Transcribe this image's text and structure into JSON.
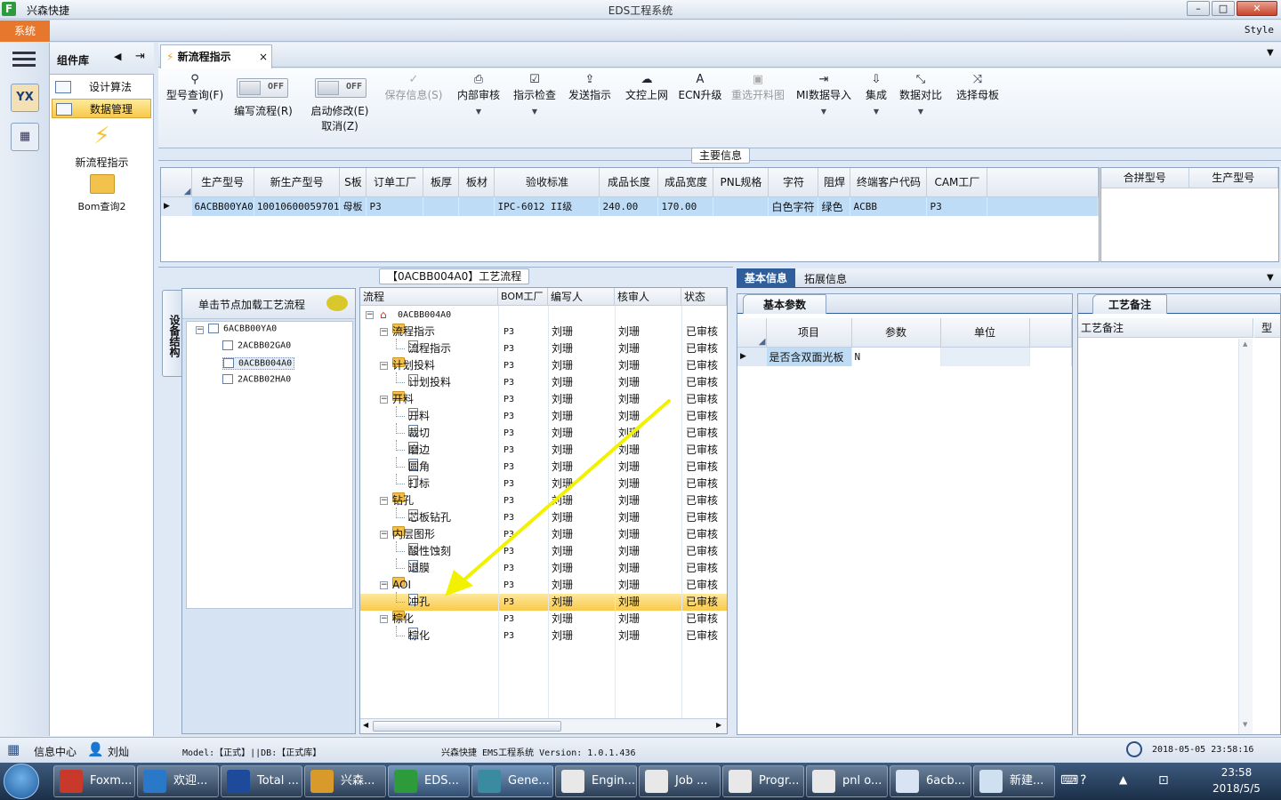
{
  "titlebar": {
    "app_name": "兴森快捷",
    "title": "EDS工程系统",
    "min": "–",
    "max": "□",
    "close": "✕"
  },
  "menubar": {
    "system_tab": "系统",
    "style_label": "Style"
  },
  "leftbar": {
    "icon1": "YX",
    "icon2": "▦"
  },
  "complib": {
    "title": "组件库",
    "items": [
      "设计算法",
      "数据管理"
    ],
    "big_items": [
      "新流程指示",
      "Bom查询2"
    ]
  },
  "doc_tab": {
    "label": "新流程指示",
    "close": "×"
  },
  "toolbar": {
    "type_query": "型号查询(F)",
    "write_flow": "编写流程(R)",
    "toggle_off": "OFF",
    "start_modify": "启动修改(E)",
    "cancel": "取消(Z)",
    "save_info": "保存信息(S)",
    "internal_review": "内部审核",
    "instruction_check": "指示检查",
    "send_instruction": "发送指示",
    "upload_doc": "文控上网",
    "ecn_upgrade": "ECN升级",
    "reselect_cut": "重选开料图",
    "mi_import": "MI数据导入",
    "integrate": "集成",
    "data_compare": "数据对比",
    "select_mother": "选择母板"
  },
  "main_info": {
    "title": "主要信息",
    "columns": [
      "生产型号",
      "新生产型号",
      "S板",
      "订单工厂",
      "板厚",
      "板材",
      "验收标准",
      "成品长度",
      "成品宽度",
      "PNL规格",
      "字符",
      "阻焊",
      "终端客户代码",
      "CAM工厂"
    ],
    "row": [
      "6ACBB00YA0",
      "10010600059701",
      "母板",
      "P3",
      "",
      "",
      "IPC-6012 II级",
      "240.00",
      "170.00",
      "",
      "白色字符",
      "绿色",
      "ACBB",
      "P3"
    ],
    "side_columns": [
      "合拼型号",
      "生产型号"
    ]
  },
  "flow_panel": {
    "title": "【0ACBB004A0】工艺流程",
    "vertical_tab": "设备结构",
    "hint": "单击节点加载工艺流程",
    "tree": [
      "6ACBB00YA0",
      "2ACBB02GA0",
      "0ACBB004A0",
      "2ACBB02HA0"
    ],
    "grid_columns": [
      "流程",
      "BOM工厂",
      "编写人",
      "核审人",
      "状态"
    ],
    "root": "0ACBB004A0",
    "rows": [
      {
        "name": "流程指示",
        "level": 1,
        "factory": "P3",
        "writer": "刘珊",
        "reviewer": "刘珊",
        "status": "已审核"
      },
      {
        "name": "流程指示",
        "level": 2,
        "factory": "P3",
        "writer": "刘珊",
        "reviewer": "刘珊",
        "status": "已审核"
      },
      {
        "name": "计划投料",
        "level": 1,
        "factory": "P3",
        "writer": "刘珊",
        "reviewer": "刘珊",
        "status": "已审核"
      },
      {
        "name": "计划投料",
        "level": 2,
        "factory": "P3",
        "writer": "刘珊",
        "reviewer": "刘珊",
        "status": "已审核"
      },
      {
        "name": "开料",
        "level": 1,
        "factory": "P3",
        "writer": "刘珊",
        "reviewer": "刘珊",
        "status": "已审核"
      },
      {
        "name": "开料",
        "level": 2,
        "factory": "P3",
        "writer": "刘珊",
        "reviewer": "刘珊",
        "status": "已审核"
      },
      {
        "name": "裁切",
        "level": 2,
        "factory": "P3",
        "writer": "刘珊",
        "reviewer": "刘珊",
        "status": "已审核"
      },
      {
        "name": "磨边",
        "level": 2,
        "factory": "P3",
        "writer": "刘珊",
        "reviewer": "刘珊",
        "status": "已审核"
      },
      {
        "name": "圆角",
        "level": 2,
        "factory": "P3",
        "writer": "刘珊",
        "reviewer": "刘珊",
        "status": "已审核"
      },
      {
        "name": "打标",
        "level": 2,
        "factory": "P3",
        "writer": "刘珊",
        "reviewer": "刘珊",
        "status": "已审核"
      },
      {
        "name": "钻孔",
        "level": 1,
        "factory": "P3",
        "writer": "刘珊",
        "reviewer": "刘珊",
        "status": "已审核"
      },
      {
        "name": "芯板钻孔",
        "level": 2,
        "factory": "P3",
        "writer": "刘珊",
        "reviewer": "刘珊",
        "status": "已审核"
      },
      {
        "name": "内层图形",
        "level": 1,
        "factory": "P3",
        "writer": "刘珊",
        "reviewer": "刘珊",
        "status": "已审核"
      },
      {
        "name": "酸性蚀刻",
        "level": 2,
        "factory": "P3",
        "writer": "刘珊",
        "reviewer": "刘珊",
        "status": "已审核"
      },
      {
        "name": "退膜",
        "level": 2,
        "factory": "P3",
        "writer": "刘珊",
        "reviewer": "刘珊",
        "status": "已审核"
      },
      {
        "name": "AOI",
        "level": 1,
        "factory": "P3",
        "writer": "刘珊",
        "reviewer": "刘珊",
        "status": "已审核"
      },
      {
        "name": "冲孔",
        "level": 2,
        "factory": "P3",
        "writer": "刘珊",
        "reviewer": "刘珊",
        "status": "已审核",
        "selected": true
      },
      {
        "name": "棕化",
        "level": 1,
        "factory": "P3",
        "writer": "刘珊",
        "reviewer": "刘珊",
        "status": "已审核"
      },
      {
        "name": "棕化",
        "level": 2,
        "factory": "P3",
        "writer": "刘珊",
        "reviewer": "刘珊",
        "status": "已审核"
      }
    ]
  },
  "right_panel": {
    "tabs": [
      "基本信息",
      "拓展信息"
    ],
    "subtab": "基本参数",
    "param_columns": [
      "项目",
      "参数",
      "单位"
    ],
    "param_row": [
      "是否含双面光板",
      "N",
      ""
    ],
    "note_tab": "工艺备注",
    "note_columns": [
      "工艺备注",
      "型"
    ]
  },
  "statusbar": {
    "info_center": "信息中心",
    "user": "刘灿",
    "model_db": "Model:【正式】||DB:【正式库】",
    "version": "兴森快捷 EMS工程系统 Version: 1.0.1.436",
    "datetime": "2018-05-05 23:58:16"
  },
  "taskbar": {
    "tasks": [
      "Foxm...",
      "欢迎...",
      "Total ...",
      "兴森...",
      "EDS...",
      "Gene...",
      "Engin...",
      "Job ...",
      "Progr...",
      "pnl o...",
      "6acb...",
      "新建..."
    ],
    "time": "23:58",
    "date": "2018/5/5"
  }
}
